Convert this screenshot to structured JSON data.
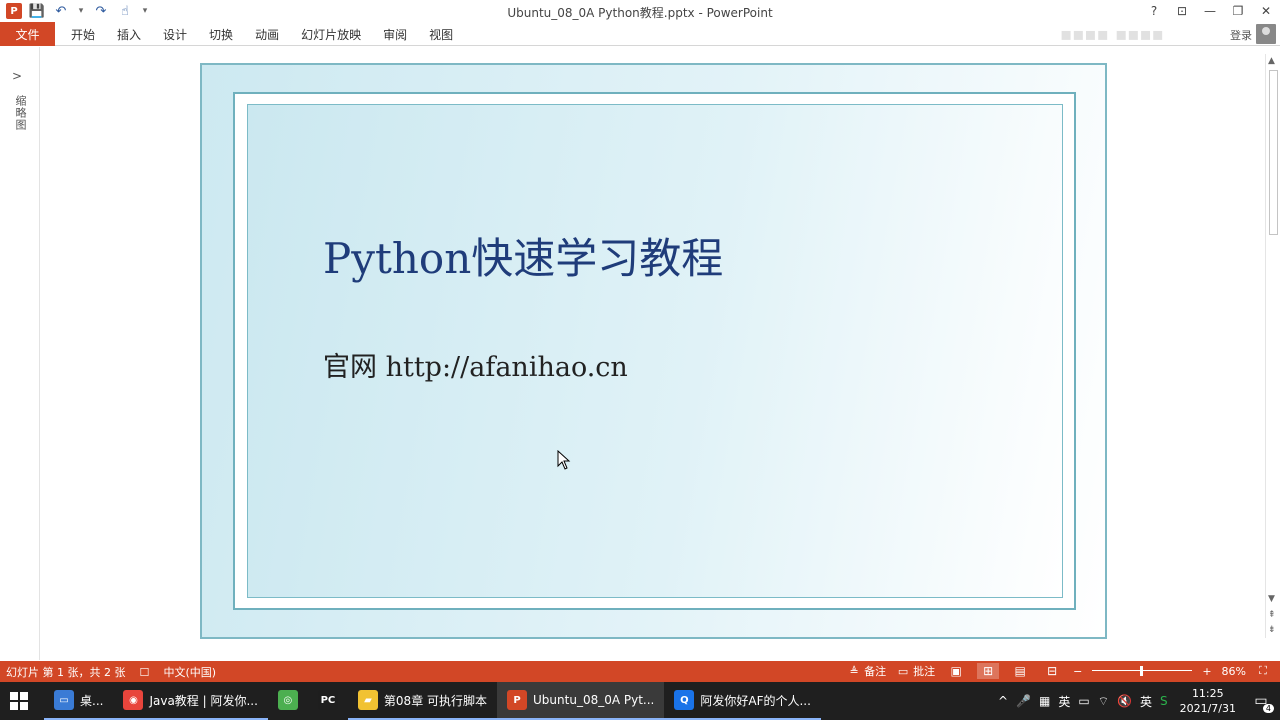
{
  "window": {
    "title": "Ubuntu_08_0A Python教程.pptx - PowerPoint",
    "app_logo": "P",
    "controls": {
      "help": "?",
      "ribbon_display": "⊡",
      "minimize": "—",
      "restore": "❐",
      "close": "✕"
    }
  },
  "qat": {
    "save_icon": "💾",
    "undo_icon": "↶",
    "redo_icon": "↷",
    "touch_icon": "☝",
    "customize_icon": "▾"
  },
  "ribbon": {
    "file_tab": "文件",
    "tabs": [
      "开始",
      "插入",
      "设计",
      "切换",
      "动画",
      "幻灯片放映",
      "审阅",
      "视图"
    ],
    "signin": "登录"
  },
  "thumbnails": {
    "expand_icon": ">",
    "label": "缩略图"
  },
  "slide": {
    "title": "Python快速学习教程",
    "subtitle": "官网 http://afanihao.cn"
  },
  "statusbar": {
    "slide_info": "幻灯片 第 1 张，共 2 张",
    "language": "中文(中国)",
    "notes": "备注",
    "comments": "批注",
    "zoom_minus": "−",
    "zoom_plus": "+",
    "zoom_percent": "86%",
    "zoom_level": 0.86
  },
  "taskbar": {
    "items": [
      {
        "label": "桌...",
        "color": "#3a7bd5"
      },
      {
        "label": "Java教程 | 阿发你...",
        "color": "#e8453c"
      },
      {
        "label": "",
        "color": "#4caf50"
      },
      {
        "label": "",
        "color": "#1e1e1e"
      },
      {
        "label": "第08章 可执行脚本",
        "color": "#f1c232"
      },
      {
        "label": "Ubuntu_08_0A Pyt...",
        "color": "#d24726"
      },
      {
        "label": "阿发你好AF的个人...",
        "color": "#1a73e8"
      }
    ],
    "tray": {
      "ime": "英",
      "time": "11:25",
      "date": "2021/7/31",
      "notifications": "4"
    }
  },
  "colors": {
    "accent": "#d24726",
    "slide_title": "#1f3c7a",
    "slide_border": "#7eb8c4"
  }
}
